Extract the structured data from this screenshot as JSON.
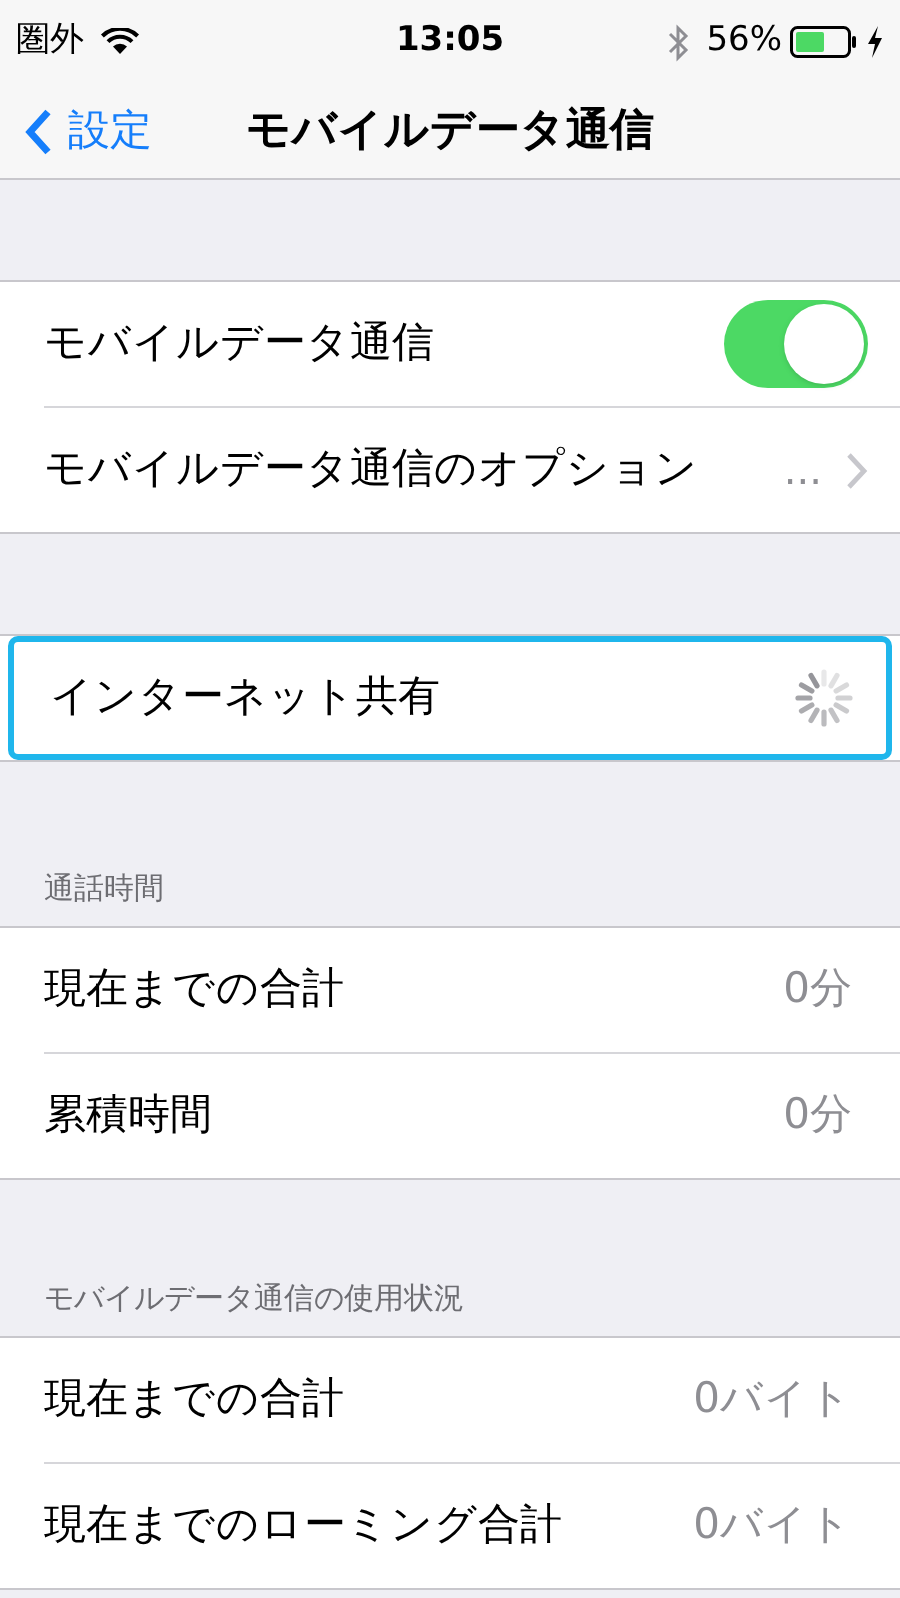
{
  "status_bar": {
    "carrier": "圏外",
    "time": "13:05",
    "battery": "56%"
  },
  "nav_bar": {
    "back": "設定",
    "title": "モバイルデータ通信"
  },
  "sections": [
    {
      "rows": [
        {
          "kind": "toggle",
          "label": "モバイルデータ通信",
          "on": true
        },
        {
          "kind": "link",
          "label": "モバイルデータ通信のオプション",
          "value": "..."
        }
      ]
    },
    {
      "rows": [
        {
          "kind": "spinner",
          "label": "インターネット共有",
          "highlighted": true
        }
      ]
    },
    {
      "header": "通話時間",
      "rows": [
        {
          "kind": "value",
          "label": "現在までの合計",
          "value": "0分"
        },
        {
          "kind": "value",
          "label": "累積時間",
          "value": "0分"
        }
      ]
    },
    {
      "header": "モバイルデータ通信の使用状況",
      "rows": [
        {
          "kind": "value",
          "label": "現在までの合計",
          "value": "0バイト"
        },
        {
          "kind": "value",
          "label": "現在までのローミング合計",
          "value": "0バイト"
        }
      ]
    }
  ]
}
